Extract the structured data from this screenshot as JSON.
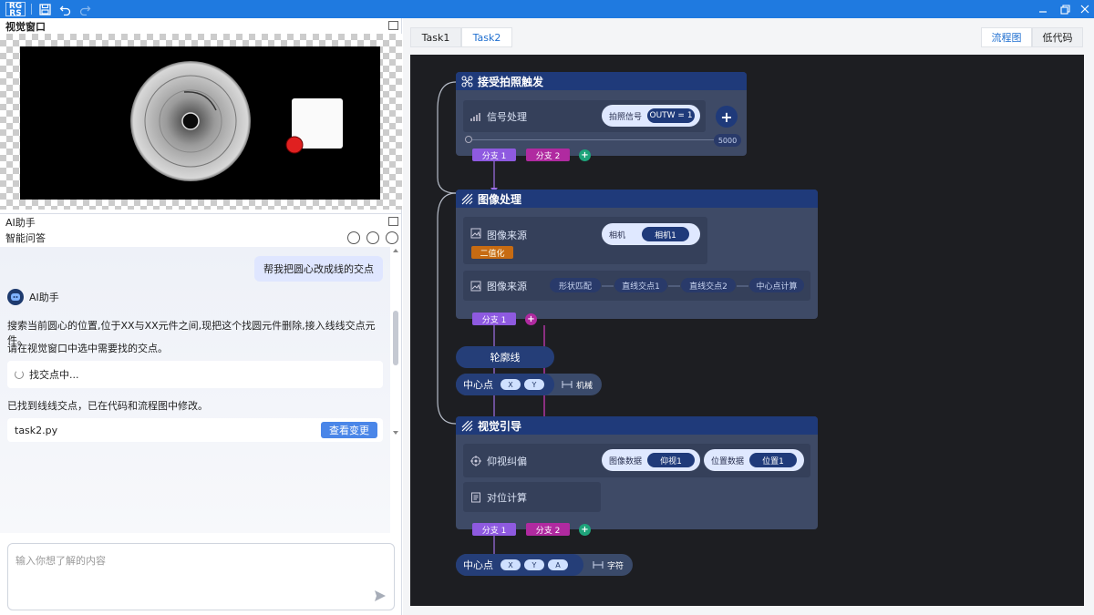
{
  "left": {
    "vision": {
      "title": "视觉窗口"
    },
    "ai": {
      "title": "AI助手",
      "sub_title": "智能问答",
      "user_msg": "帮我把圆心改成线的交点",
      "bot_name": "AI助手",
      "msg1": "搜索当前圆心的位置,位于XX与XX元件之间,现把这个找圆元件删除,接入线线交点元件。",
      "msg2": "请在视觉窗口中选中需要找的交点。",
      "loading": "找交点中...",
      "msg3": "已找到线线交点，已在代码和流程图中修改。",
      "file": "task2.py",
      "view_changes": "查看变更",
      "input_placeholder": "输入你想了解的内容"
    }
  },
  "right": {
    "tabs": [
      "Task1",
      "Task2"
    ],
    "view_tabs": [
      "流程图",
      "低代码"
    ],
    "flow": {
      "n1": {
        "title": "接受拍照触发",
        "row_label": "信号处理",
        "pill_label": "拍照信号",
        "pill_value": "OUTW = 1",
        "counter": "5000",
        "branch1": "分支 1",
        "branch2": "分支 2"
      },
      "n2": {
        "title": "图像处理",
        "row1_label": "图像来源",
        "pill_label": "相机",
        "pill_value": "相机1",
        "tag": "二值化",
        "row2_label": "图像来源",
        "steps": [
          "形状匹配",
          "直线交点1",
          "直线交点2",
          "中心点计算"
        ],
        "branch1": "分支 1"
      },
      "contour": "轮廓线",
      "center1": {
        "label": "中心点",
        "x": "X",
        "y": "Y",
        "extra": "机械"
      },
      "n3": {
        "title": "视觉引导",
        "row1_label": "仰视纠偏",
        "pill1_label": "图像数据",
        "pill1_value": "仰视1",
        "pill2_label": "位置数据",
        "pill2_value": "位置1",
        "row2_label": "对位计算",
        "branch1": "分支 1",
        "branch2": "分支 2"
      },
      "center2": {
        "label": "中心点",
        "x": "X",
        "y": "Y",
        "a": "A",
        "extra": "字符"
      }
    }
  },
  "colors": {
    "accent": "#1f7ae0",
    "canvas": "#1d1e22",
    "node_bg": "#3e4a66",
    "node_head": "#1f3a7a",
    "branch_purple": "#8e5ae0",
    "branch_magenta": "#b02aa0",
    "plus_green": "#1ea37a",
    "tag_orange": "#c76b12",
    "wire_purple": "#a070e8",
    "wire_magenta": "#d33bc0"
  }
}
